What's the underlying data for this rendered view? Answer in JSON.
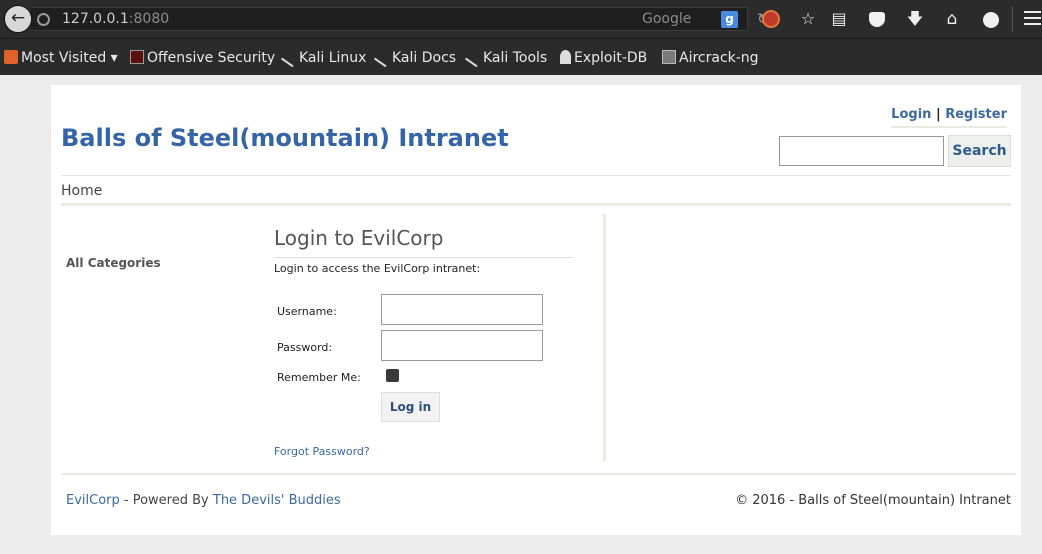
{
  "browser": {
    "url_host": "127.0.0.1",
    "url_port": ":8080",
    "search_engine": "Google",
    "search_engine_badge": "g",
    "icons": [
      "back-icon",
      "globe-icon",
      "reload-icon",
      "ublock-icon",
      "bookmark-star-icon",
      "reading-list-icon",
      "pocket-icon",
      "download-icon",
      "home-icon",
      "chat-icon",
      "menu-icon"
    ]
  },
  "bookmarks": [
    {
      "label": "Most Visited ▾",
      "icon": "folder-icon"
    },
    {
      "label": "Offensive Security",
      "icon": "offsec-icon"
    },
    {
      "label": "Kali Linux",
      "icon": "kali-icon"
    },
    {
      "label": "Kali Docs",
      "icon": "kali-icon"
    },
    {
      "label": "Kali Tools",
      "icon": "kali-icon"
    },
    {
      "label": "Exploit-DB",
      "icon": "exploitdb-icon"
    },
    {
      "label": "Aircrack-ng",
      "icon": "aircrack-icon"
    }
  ],
  "site": {
    "title": "Balls of Steel(mountain) Intranet",
    "login_link": "Login",
    "link_separator": "|",
    "register_link": "Register",
    "search_button": "Search",
    "nav_home": "Home",
    "sidebar_heading": "All Categories"
  },
  "login": {
    "title": "Login to EvilCorp",
    "subtitle": "Login to access the EvilCorp intranet:",
    "username_label": "Username:",
    "password_label": "Password:",
    "remember_label": "Remember Me:",
    "submit_label": "Log in",
    "forgot_link": "Forgot Password?"
  },
  "footer": {
    "company_link": "EvilCorp",
    "powered_by_text": " - Powered By ",
    "powered_by_link": "The Devils' Buddies",
    "copyright": "© 2016 - Balls of Steel(mountain) Intranet"
  }
}
